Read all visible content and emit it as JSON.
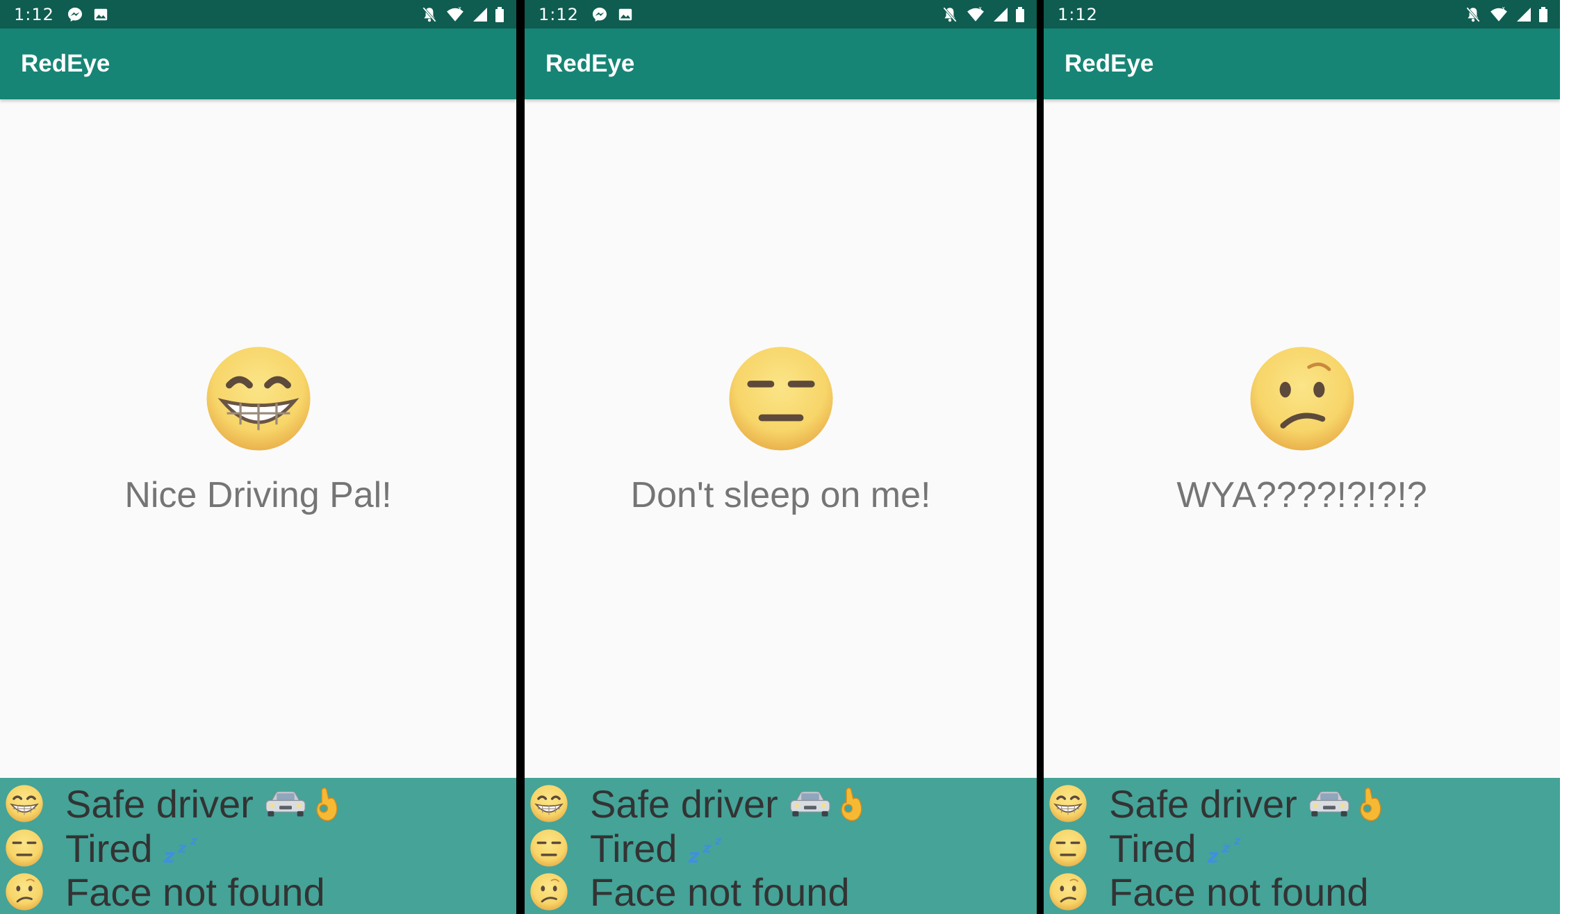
{
  "screens": [
    {
      "status_bar": {
        "time": "1:12",
        "left_icons": [
          "messenger-icon",
          "image-icon"
        ],
        "right_icons": [
          "mute-icon",
          "wifi-icon",
          "signal-icon",
          "battery-icon"
        ]
      },
      "app_bar": {
        "title": "RedEye"
      },
      "main": {
        "emoji": "grinning-face-icon",
        "message": "Nice Driving Pal!"
      },
      "legend": [
        {
          "emoji": "grinning-face-icon",
          "label": "Safe driver",
          "extras": [
            "car-icon",
            "ok-hand-icon"
          ]
        },
        {
          "emoji": "expressionless-face-icon",
          "label": "Tired",
          "extras": [
            "zzz-icon"
          ]
        },
        {
          "emoji": "confused-face-icon",
          "label": "Face not found",
          "extras": []
        }
      ]
    },
    {
      "status_bar": {
        "time": "1:12",
        "left_icons": [
          "messenger-icon",
          "image-icon"
        ],
        "right_icons": [
          "mute-icon",
          "wifi-icon",
          "signal-icon",
          "battery-icon"
        ]
      },
      "app_bar": {
        "title": "RedEye"
      },
      "main": {
        "emoji": "expressionless-face-icon",
        "message": "Don't sleep on me!"
      },
      "legend": [
        {
          "emoji": "grinning-face-icon",
          "label": "Safe driver",
          "extras": [
            "car-icon",
            "ok-hand-icon"
          ]
        },
        {
          "emoji": "expressionless-face-icon",
          "label": "Tired",
          "extras": [
            "zzz-icon"
          ]
        },
        {
          "emoji": "confused-face-icon",
          "label": "Face not found",
          "extras": []
        }
      ]
    },
    {
      "status_bar": {
        "time": "1:12",
        "left_icons": [],
        "right_icons": [
          "mute-icon",
          "wifi-icon",
          "signal-icon",
          "battery-icon"
        ]
      },
      "app_bar": {
        "title": "RedEye"
      },
      "main": {
        "emoji": "confused-face-icon",
        "message": "WYA????!?!?!?"
      },
      "legend": [
        {
          "emoji": "grinning-face-icon",
          "label": "Safe driver",
          "extras": [
            "car-icon",
            "ok-hand-icon"
          ]
        },
        {
          "emoji": "expressionless-face-icon",
          "label": "Tired",
          "extras": [
            "zzz-icon"
          ]
        },
        {
          "emoji": "confused-face-icon",
          "label": "Face not found",
          "extras": []
        }
      ]
    }
  ],
  "colors": {
    "status_bar": "#0f5c50",
    "app_bar": "#168575",
    "legend_background": "#45a398",
    "content_background": "#fafafa",
    "message_text": "#757575",
    "legend_text": "#333333",
    "emoji_face": "#f7d569"
  }
}
